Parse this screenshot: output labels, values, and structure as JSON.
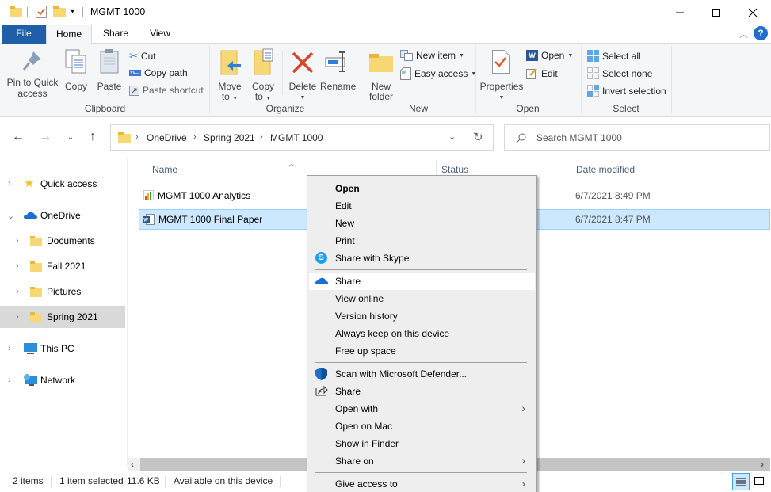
{
  "window": {
    "title": "MGMT 1000",
    "controls": {
      "minimize": "minimize",
      "maximize": "maximize",
      "close": "close"
    }
  },
  "quick_access_toolbar": [
    "folder-icon",
    "properties-icon",
    "new-folder-icon",
    "customize-dropdown"
  ],
  "ribbon": {
    "tabs": [
      {
        "label": "File",
        "active": false
      },
      {
        "label": "Home",
        "active": true
      },
      {
        "label": "Share",
        "active": false
      },
      {
        "label": "View",
        "active": false
      }
    ],
    "groups": {
      "clipboard": {
        "label": "Clipboard",
        "pin": "Pin to Quick access",
        "pin_line1": "Pin to Quick",
        "pin_line2": "access",
        "copy": "Copy",
        "paste": "Paste",
        "cut": "Cut",
        "copy_path": "Copy path",
        "paste_shortcut": "Paste shortcut"
      },
      "organize": {
        "label": "Organize",
        "move_to_1": "Move",
        "move_to_2": "to",
        "copy_to_1": "Copy",
        "copy_to_2": "to",
        "delete": "Delete",
        "rename": "Rename"
      },
      "new": {
        "label": "New",
        "new_folder_1": "New",
        "new_folder_2": "folder",
        "new_item": "New item",
        "easy_access": "Easy access"
      },
      "open": {
        "label": "Open",
        "properties": "Properties",
        "open": "Open",
        "edit": "Edit"
      },
      "select": {
        "label": "Select",
        "select_all": "Select all",
        "select_none": "Select none",
        "invert": "Invert selection"
      }
    }
  },
  "address": {
    "breadcrumbs": [
      "OneDrive",
      "Spring 2021",
      "MGMT 1000"
    ],
    "search_placeholder": "Search MGMT 1000"
  },
  "nav_pane": {
    "items": [
      {
        "label": "Quick access",
        "icon": "star-icon",
        "expanded": false,
        "level": 0
      },
      {
        "label": "OneDrive",
        "icon": "cloud-icon",
        "expanded": true,
        "level": 0
      },
      {
        "label": "Documents",
        "icon": "folder-icon",
        "level": 1
      },
      {
        "label": "Fall 2021",
        "icon": "folder-icon",
        "level": 1
      },
      {
        "label": "Pictures",
        "icon": "folder-icon",
        "level": 1
      },
      {
        "label": "Spring 2021",
        "icon": "folder-icon",
        "level": 1,
        "selected": true
      },
      {
        "label": "This PC",
        "icon": "computer-icon",
        "level": 0
      },
      {
        "label": "Network",
        "icon": "network-icon",
        "level": 0
      }
    ]
  },
  "file_list": {
    "columns": [
      "Name",
      "Status",
      "Date modified"
    ],
    "sort_column": "Name",
    "rows": [
      {
        "name": "MGMT 1000 Analytics",
        "icon": "spreadsheet-chart-icon",
        "date": "6/7/2021 8:49 PM",
        "selected": false
      },
      {
        "name": "MGMT 1000 Final Paper",
        "icon": "word-document-icon",
        "date": "6/7/2021 8:47 PM",
        "selected": true
      }
    ]
  },
  "context_menu": {
    "items": [
      {
        "label": "Open",
        "bold": true
      },
      {
        "label": "Edit"
      },
      {
        "label": "New"
      },
      {
        "label": "Print"
      },
      {
        "label": "Share with Skype",
        "icon": "skype-icon"
      },
      {
        "label": "Share",
        "icon": "onedrive-cloud-icon",
        "highlighted": true
      },
      {
        "label": "View online"
      },
      {
        "label": "Version history"
      },
      {
        "label": "Always keep on this device"
      },
      {
        "label": "Free up space"
      },
      {
        "label": "Scan with Microsoft Defender...",
        "icon": "defender-shield-icon"
      },
      {
        "label": "Share",
        "icon": "share-icon"
      },
      {
        "label": "Open with",
        "submenu": true
      },
      {
        "label": "Open on Mac"
      },
      {
        "label": "Show in Finder"
      },
      {
        "label": "Share on",
        "submenu": true
      },
      {
        "label": "Give access to",
        "submenu": true
      }
    ]
  },
  "status_bar": {
    "item_count": "2 items",
    "selection": "1 item selected",
    "size": "11.6 KB",
    "availability": "Available on this device",
    "view_modes": [
      "details-view",
      "large-icons-view"
    ],
    "active_view": "details-view"
  },
  "colors": {
    "accent": "#1e5fa8",
    "selection_bg": "#cce8ff",
    "selection_border": "#99d1ff",
    "folder": "#f8d775",
    "menu_bg": "#eeeeee"
  }
}
